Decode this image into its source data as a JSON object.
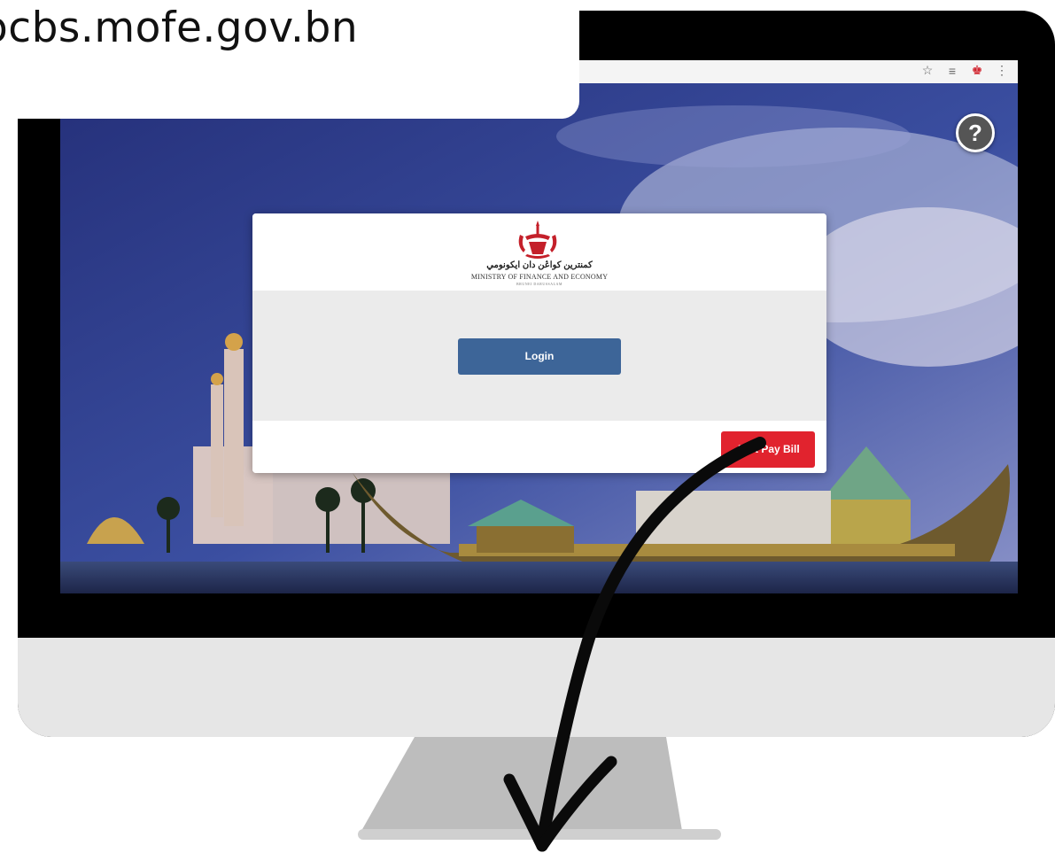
{
  "callout": {
    "url": "ocbs.mofe.gov.bn"
  },
  "browser": {
    "icons": [
      "star-icon",
      "reading-list-icon",
      "extension-icon",
      "menu-dots-icon"
    ]
  },
  "login_card": {
    "logo_jawi": "كمنترين كواڠن دان ايكونومي",
    "logo_english": "MINISTRY OF FINANCE AND ECONOMY",
    "logo_subtitle": "BRUNEI DARUSSALAM",
    "login_label": "Login",
    "pay_bill_label": "Just Pay Bill"
  },
  "help": {
    "label": "?"
  },
  "colors": {
    "login_button": "#3d6598",
    "pay_bill_button": "#e1232e",
    "sky": "#2f3e86",
    "monitor_bezel": "#000000",
    "monitor_chin": "#e6e6e6"
  }
}
